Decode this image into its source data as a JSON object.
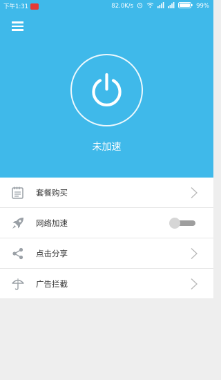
{
  "status_bar": {
    "time": "下午1:31",
    "speed": "82.0K/s",
    "battery": "99%",
    "icons": [
      "alarm-icon",
      "wifi-icon",
      "signal-icon",
      "battery-icon"
    ]
  },
  "header": {
    "menu_icon": "menu-icon",
    "power_icon": "power-icon",
    "status_label": "未加速",
    "accent_color": "#3fb9ea"
  },
  "menu": {
    "items": [
      {
        "label": "套餐购买",
        "icon": "notepad-icon",
        "trailing": "chevron"
      },
      {
        "label": "网络加速",
        "icon": "rocket-icon",
        "trailing": "toggle",
        "toggle_on": false
      },
      {
        "label": "点击分享",
        "icon": "share-icon",
        "trailing": "chevron"
      },
      {
        "label": "广告拦截",
        "icon": "umbrella-icon",
        "trailing": "chevron"
      }
    ]
  }
}
